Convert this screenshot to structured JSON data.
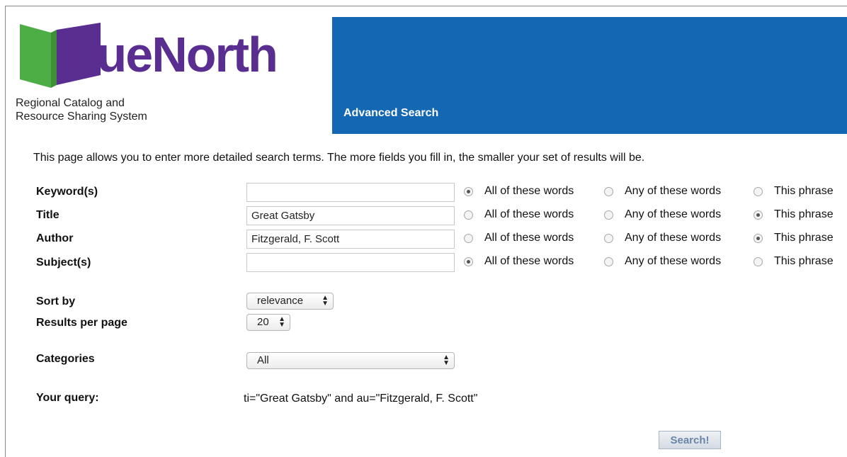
{
  "brand": {
    "name": "DueNorth",
    "tagline_line1": "Regional Catalog and",
    "tagline_line2": "Resource Sharing System",
    "logo_colors": {
      "green": "#4cae45",
      "purple": "#5a2d91"
    }
  },
  "banner": {
    "title": "Advanced Search",
    "color": "#1467b3"
  },
  "intro": "This page allows you to enter more detailed search terms. The more fields you fill in, the smaller your set of results will be.",
  "fields": [
    {
      "label": "Keyword(s)",
      "value": "",
      "selected_mode": "all"
    },
    {
      "label": "Title",
      "value": "Great Gatsby",
      "selected_mode": "phrase"
    },
    {
      "label": "Author",
      "value": "Fitzgerald, F. Scott",
      "selected_mode": "phrase"
    },
    {
      "label": "Subject(s)",
      "value": "",
      "selected_mode": "all"
    }
  ],
  "match_options": {
    "all": "All of these words",
    "any": "Any of these words",
    "phrase": "This phrase"
  },
  "sort": {
    "label": "Sort by",
    "value": "relevance"
  },
  "per_page": {
    "label": "Results per page",
    "value": "20"
  },
  "categories": {
    "label": "Categories",
    "value": "All"
  },
  "query": {
    "label": "Your query:",
    "value": "ti=\"Great Gatsby\" and au=\"Fitzgerald, F. Scott\""
  },
  "search_button": "Search!"
}
